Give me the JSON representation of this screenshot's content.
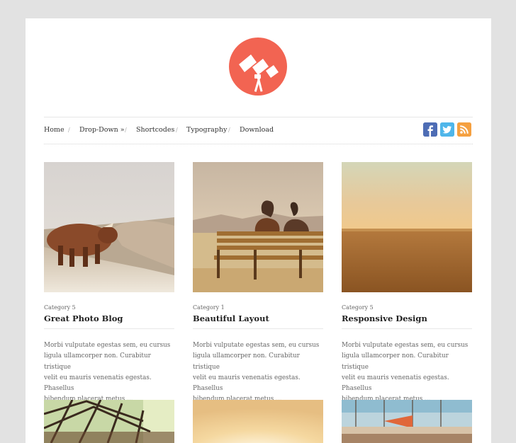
{
  "site": {
    "logo_icon": "telescope-icon",
    "brand_color": "#f26452"
  },
  "nav": {
    "items": [
      {
        "label": "Home"
      },
      {
        "label": "Drop-Down »"
      },
      {
        "label": "Shortcodes"
      },
      {
        "label": "Typography"
      },
      {
        "label": "Download"
      }
    ],
    "separator": "/"
  },
  "social": [
    {
      "icon": "facebook-icon",
      "glyph": "f",
      "color": "#3b5998"
    },
    {
      "icon": "twitter-icon",
      "color": "#33a9e0"
    },
    {
      "icon": "rss-icon",
      "color": "#f39220"
    }
  ],
  "posts": [
    {
      "category": "Category 5",
      "title": "Great Photo Blog",
      "excerpt_lines": [
        "Morbi vulputate egestas sem, eu cursus",
        "ligula ullamcorper non. Curabitur tristique",
        "velit eu mauris venenatis egestas. Phasellus",
        "bibendum placerat metus,..."
      ]
    },
    {
      "category": "Category 1",
      "title": "Beautiful Layout",
      "excerpt_lines": [
        "Morbi vulputate egestas sem, eu cursus",
        "ligula ullamcorper non. Curabitur tristique",
        "velit eu mauris venenatis egestas. Phasellus",
        "bibendum placerat metus,..."
      ]
    },
    {
      "category": "Category 5",
      "title": "Responsive Design",
      "excerpt_lines": [
        "Morbi vulputate egestas sem, eu cursus",
        "ligula ullamcorper non. Curabitur tristique",
        "velit eu mauris venenatis egestas. Phasellus",
        "bibendum placerat metus,..."
      ]
    }
  ]
}
